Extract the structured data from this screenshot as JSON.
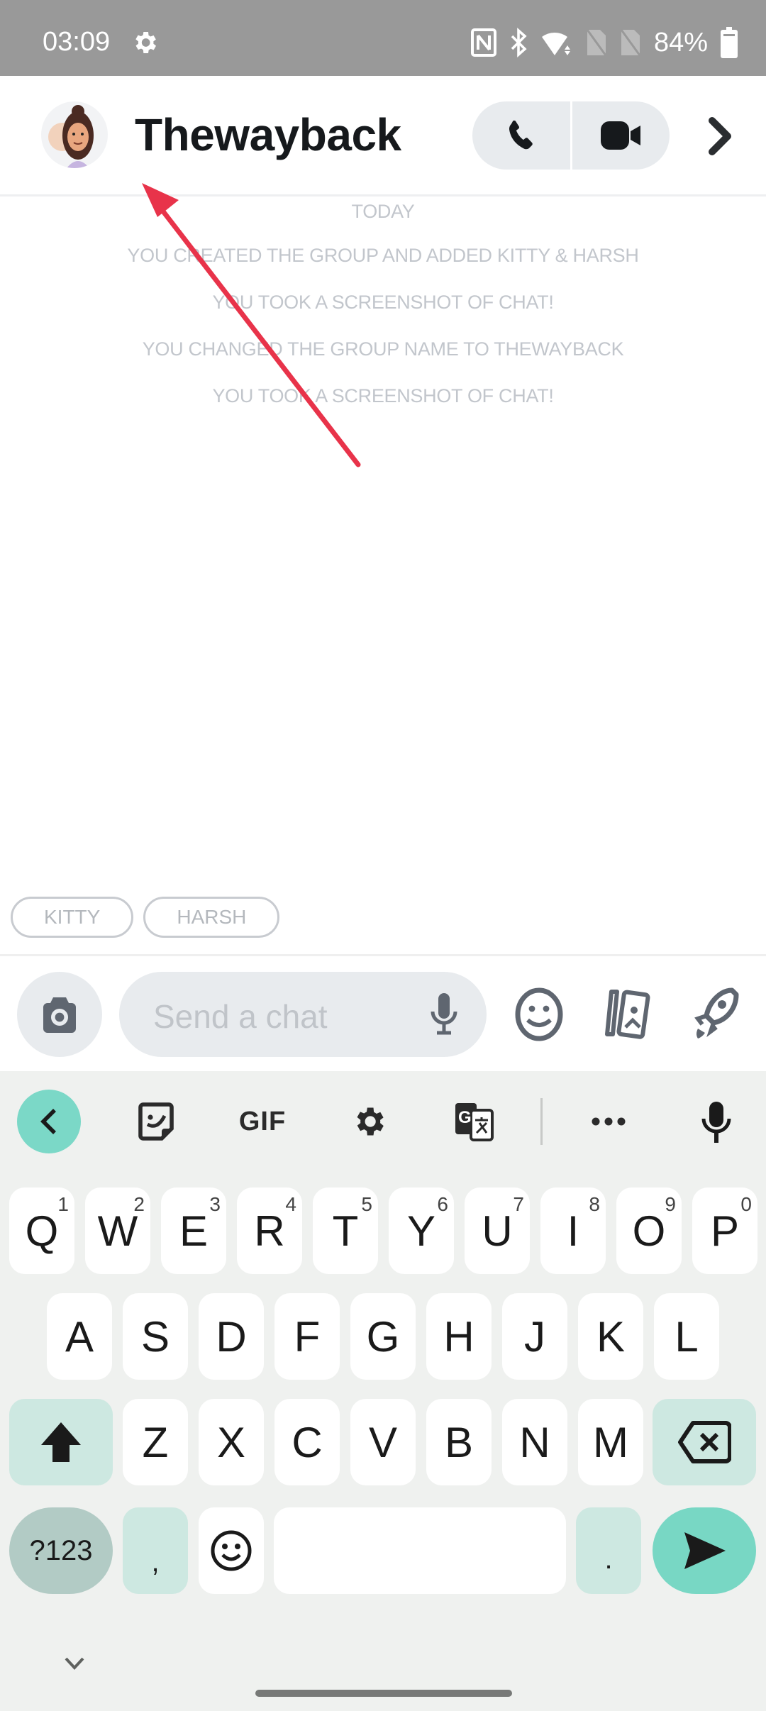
{
  "status_bar": {
    "time": "03:09",
    "battery_percent": "84%",
    "icons": [
      "settings-icon",
      "nfc-icon",
      "bluetooth-icon",
      "wifi-icon",
      "no-sim-icon",
      "no-sim-icon",
      "battery-icon"
    ]
  },
  "header": {
    "group_name": "Thewayback",
    "avatar": "bitmoji-avatar",
    "actions": [
      "voice-call",
      "video-call",
      "more-chevron"
    ]
  },
  "messages": {
    "date_label": "TODAY",
    "system_messages": [
      "YOU CREATED THE GROUP AND ADDED KITTY & HARSH",
      "YOU TOOK A SCREENSHOT OF CHAT!",
      "YOU CHANGED THE GROUP NAME TO THEWAYBACK",
      "YOU TOOK A SCREENSHOT OF CHAT!"
    ]
  },
  "mention_chips": [
    "KITTY",
    "HARSH"
  ],
  "composer": {
    "placeholder": "Send a chat"
  },
  "keyboard": {
    "toolbar": {
      "gif_label": "GIF"
    },
    "row1": [
      {
        "key": "Q",
        "hint": "1"
      },
      {
        "key": "W",
        "hint": "2"
      },
      {
        "key": "E",
        "hint": "3"
      },
      {
        "key": "R",
        "hint": "4"
      },
      {
        "key": "T",
        "hint": "5"
      },
      {
        "key": "Y",
        "hint": "6"
      },
      {
        "key": "U",
        "hint": "7"
      },
      {
        "key": "I",
        "hint": "8"
      },
      {
        "key": "O",
        "hint": "9"
      },
      {
        "key": "P",
        "hint": "0"
      }
    ],
    "row2": [
      "A",
      "S",
      "D",
      "F",
      "G",
      "H",
      "J",
      "K",
      "L"
    ],
    "row3": [
      "Z",
      "X",
      "C",
      "V",
      "B",
      "N",
      "M"
    ],
    "symbols_label": "?123",
    "comma": ",",
    "period": "."
  },
  "colors": {
    "accent_teal": "#78d7c4",
    "annotation_arrow": "#e8334a"
  }
}
